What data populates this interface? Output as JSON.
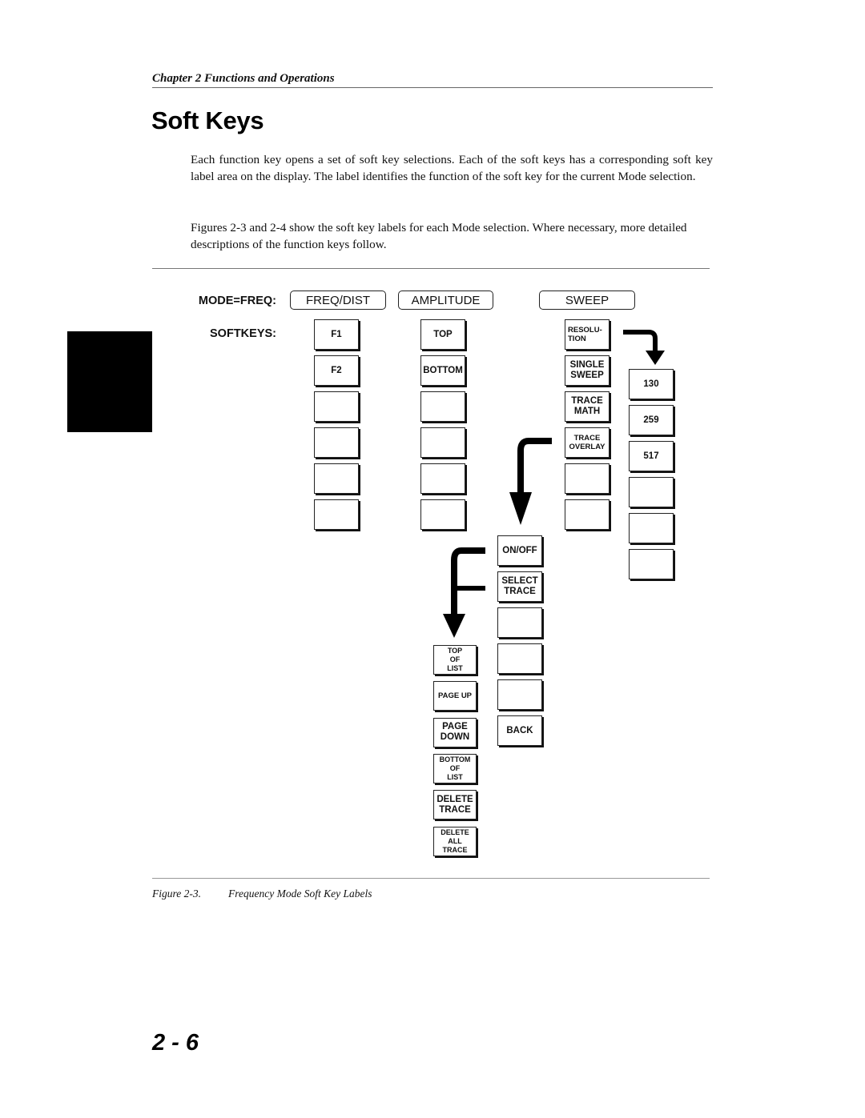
{
  "header": {
    "chapter": "Chapter 2 Functions and Operations"
  },
  "page_title": "Soft Keys",
  "paragraphs": [
    "Each function key opens a set of soft key selections. Each of the soft keys has a corresponding soft key label area on the display. The label identifies the function of the soft key for the current Mode selection.",
    "Figures 2-3 and 2-4 show the soft key labels for each Mode selection. Where necessary, more detailed descriptions of the function keys follow."
  ],
  "figure": {
    "mode_label": "MODE=FREQ:",
    "softkeys_label": "SOFTKEYS:",
    "function_keys": [
      {
        "id": "freq-dist",
        "label": "FREQ/DIST"
      },
      {
        "id": "amplitude",
        "label": "AMPLITUDE"
      },
      {
        "id": "sweep",
        "label": "SWEEP"
      }
    ],
    "columns": {
      "freq_dist": [
        "F1",
        "F2",
        "",
        "",
        "",
        ""
      ],
      "amplitude": [
        "TOP",
        "BOTTOM",
        "",
        "",
        "",
        ""
      ],
      "sweep": [
        "RESOLU-\nTION",
        "SINGLE\nSWEEP",
        "TRACE\nMATH",
        "TRACE\nOVERLAY",
        "",
        ""
      ],
      "resolution_sub": [
        "130",
        "259",
        "517",
        "",
        "",
        ""
      ],
      "trace_overlay_sub": [
        "ON/OFF",
        "SELECT\nTRACE",
        "",
        "",
        "",
        "BACK"
      ],
      "select_trace_sub": [
        "TOP\nOF\nLIST",
        "PAGE UP",
        "PAGE\nDOWN",
        "BOTTOM\nOF\nLIST",
        "DELETE\nTRACE",
        "DELETE\nALL\nTRACE"
      ]
    },
    "caption_number": "Figure 2-3.",
    "caption_text": "Frequency Mode Soft Key Labels"
  },
  "page_number": "2 - 6"
}
